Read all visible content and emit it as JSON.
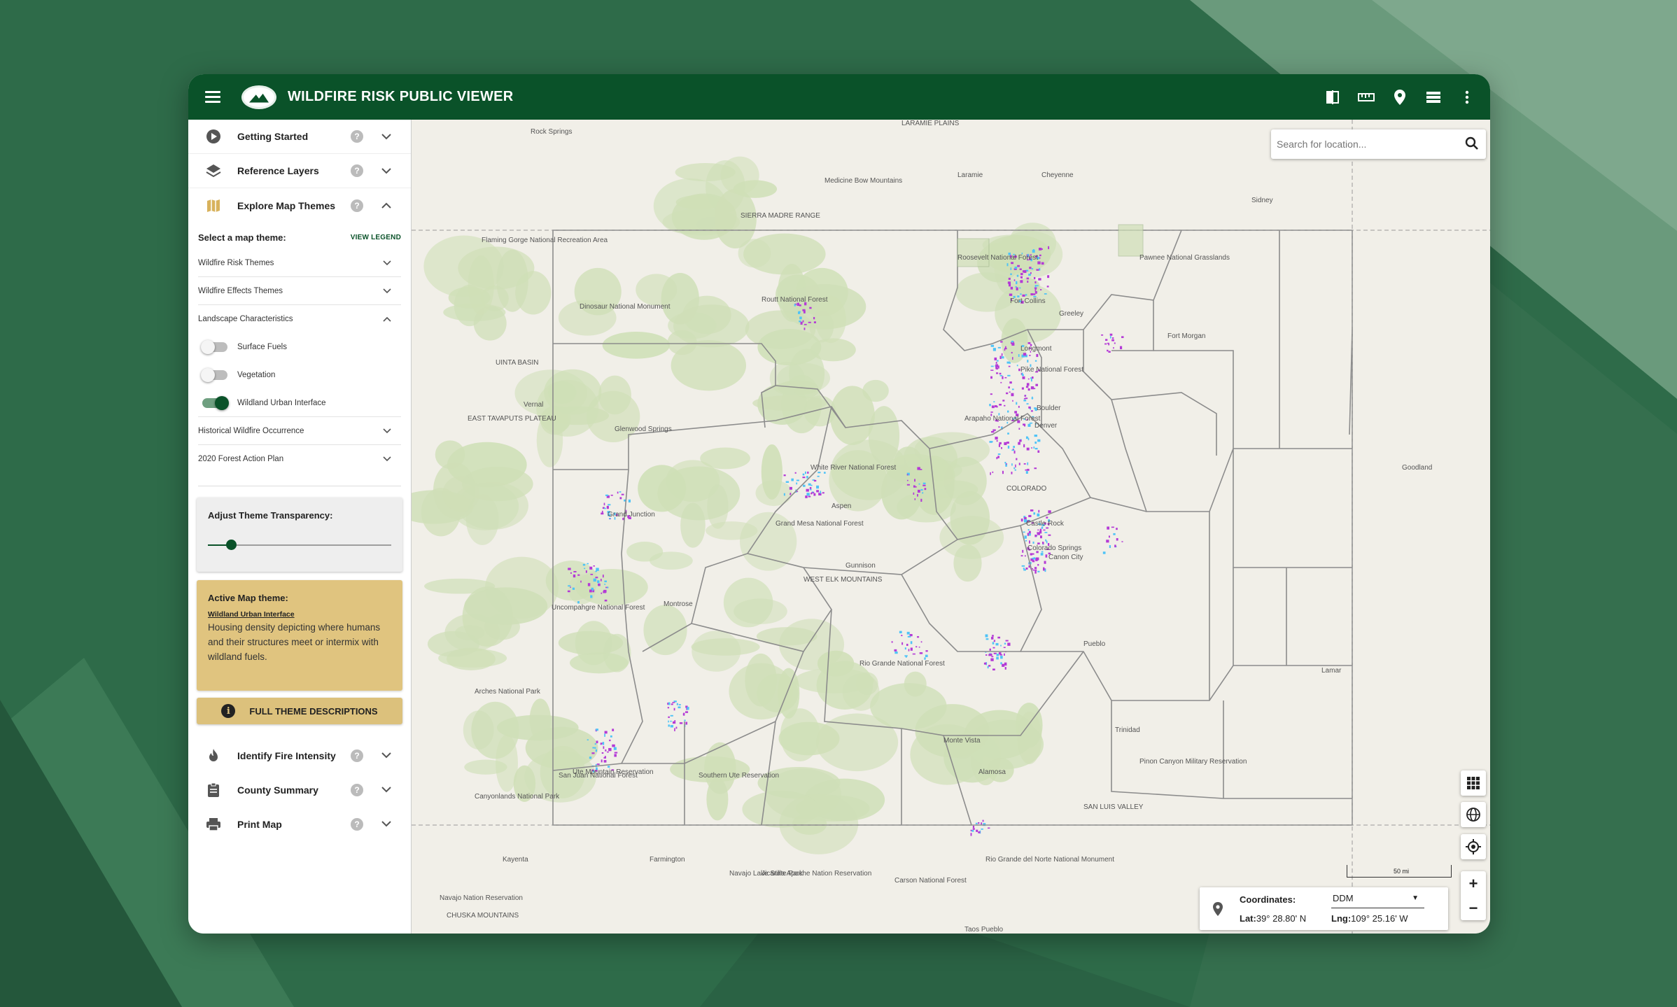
{
  "app": {
    "title": "WILDFIRE RISK PUBLIC VIEWER"
  },
  "sidebar": {
    "sections_top": [
      {
        "label": "Getting Started",
        "icon": "play-circle-icon"
      },
      {
        "label": "Reference Layers",
        "icon": "layers-icon"
      },
      {
        "label": "Explore Map Themes",
        "icon": "map-icon"
      }
    ],
    "themes": {
      "select_label": "Select a map theme:",
      "view_legend": "VIEW LEGEND",
      "groups": [
        "Wildfire Risk Themes",
        "Wildfire Effects Themes",
        "Landscape Characteristics",
        "Historical Wildfire Occurrence",
        "2020 Forest Action Plan"
      ],
      "toggles": [
        {
          "label": "Surface Fuels",
          "on": false
        },
        {
          "label": "Vegetation",
          "on": false
        },
        {
          "label": "Wildland Urban Interface",
          "on": true
        }
      ]
    },
    "transparency": {
      "label": "Adjust Theme Transparency:",
      "value": 0.12
    },
    "active_theme": {
      "heading": "Active Map theme:",
      "name": "Wildland Urban Interface",
      "description": "Housing density depicting where humans and their structures meet or intermix with wildland fuels."
    },
    "full_desc_button": "FULL THEME DESCRIPTIONS",
    "sections_bottom": [
      {
        "label": "Identify Fire Intensity",
        "icon": "fire-icon"
      },
      {
        "label": "County Summary",
        "icon": "clipboard-icon"
      },
      {
        "label": "Print Map",
        "icon": "printer-icon"
      }
    ]
  },
  "map": {
    "search_placeholder": "Search for location...",
    "scale_label": "50 mi",
    "coords": {
      "label": "Coordinates:",
      "format": "DDM",
      "lat_label": "Lat:",
      "lat": "39° 28.80' N",
      "lng_label": "Lng:",
      "lng": "109° 25.16' W"
    },
    "labels": [
      "Rock Springs",
      "LARAMIE PLAINS",
      "Laramie",
      "Cheyenne",
      "Sidney",
      "SIERRA MADRE RANGE",
      "Flaming Gorge National Recreation Area",
      "UINTA BASIN",
      "Vernal",
      "Dinosaur National Monument",
      "EAST TAVAPUTS PLATEAU",
      "Pawnee National Grasslands",
      "Fort Collins",
      "Greeley",
      "Fort Morgan",
      "Longmont",
      "Denver",
      "Boulder",
      "Castle Rock",
      "Colorado Springs",
      "Pueblo",
      "Canon City",
      "Grand Junction",
      "Glenwood Springs",
      "Aspen",
      "Gunnison",
      "Montrose",
      "Grand Mesa National Forest",
      "White River National Forest",
      "COLORADO",
      "WEST ELK MOUNTAINS",
      "Uncompahgre National Forest",
      "Rio Grande National Forest",
      "San Juan National Forest",
      "Monte Vista",
      "Alamosa",
      "SAN LUIS VALLEY",
      "Trinidad",
      "Lamar",
      "Goodland",
      "Pinon Canyon Military Reservation",
      "Ute Mountain Reservation",
      "Southern Ute Reservation",
      "Kayenta",
      "Farmington",
      "Navajo Lake State Park",
      "Jicarilla Apache Nation Reservation",
      "Carson National Forest",
      "Taos Pueblo",
      "Rio Grande del Norte National Monument",
      "Navajo Nation Reservation",
      "CHUSKA MOUNTAINS",
      "Arches National Park",
      "Canyonlands National Park",
      "Roosevelt National Forest",
      "Arapaho National Forest",
      "Pike National Forest",
      "Routt National Forest",
      "Medicine Bow Mountains"
    ],
    "colors": {
      "wui_high": "#b43ad6",
      "wui_low": "#4fc3f7",
      "forest": "#cbdcb2",
      "base": "#f1efe8"
    }
  }
}
